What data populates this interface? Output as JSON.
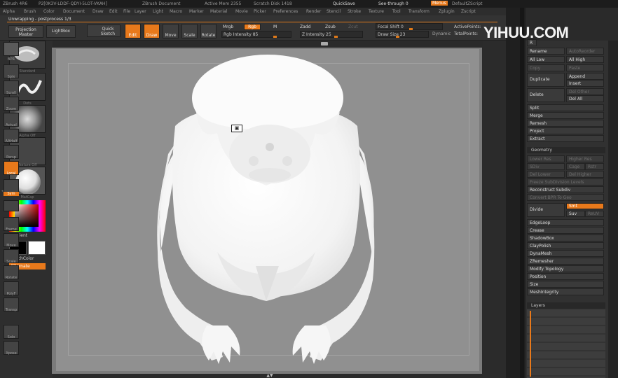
{
  "title_bar": {
    "app": "ZBrush 4R6",
    "doc_id": "P2[0K3V-LDDF-QDYI-5LOT-VKAH]",
    "document": "ZBrush Document",
    "active_mem": "Active Mem 2355",
    "scratch_disk": "Scratch Disk 1418",
    "quicksave": "QuickSave",
    "see_through": "See-through 0",
    "menus": "Menus",
    "script": "DefaultZScript"
  },
  "menus": [
    "Alpha",
    "Brush",
    "Color",
    "Document",
    "Draw",
    "Edit",
    "File",
    "Layer",
    "Light",
    "Macro",
    "Marker",
    "Material",
    "Movie",
    "Picker",
    "Preferences",
    "Render",
    "Stencil",
    "Stroke",
    "Texture",
    "Tool",
    "Transform",
    "Zplugin",
    "Zscript"
  ],
  "tabline": {
    "label": "Unwrapping - postprocess 1/3"
  },
  "toolbar": {
    "projection_master": "Projection Master",
    "lightbox": "LightBox",
    "quick_sketch": "Quick Sketch",
    "edit": "Edit",
    "draw": "Draw",
    "move": "Move",
    "scale": "Scale",
    "rotate": "Rotate",
    "mrgb": "Mrgb",
    "rgb": "Rgb",
    "m": "M",
    "zadd": "Zadd",
    "zsub": "Zsub",
    "zcut": "Zcut",
    "rgb_intensity": "Rgb Intensity 85",
    "z_intensity": "Z Intensity 25",
    "focal_shift": "Focal Shift 0",
    "draw_size": "Draw Size 23",
    "dynamic": "Dynamic",
    "active_points": "ActivePoints:",
    "total_points": "TotalPoints:"
  },
  "left_shelf": {
    "brush_label": "Standard",
    "stroke_label": "Dots",
    "alpha_label": "Alpha Off",
    "texture_label": "Texture Off",
    "material_label": "MatCap",
    "gradient": "Gradient",
    "switch_color": "SwitchColor",
    "alternate": "Alternate"
  },
  "right_shelf": {
    "items": [
      "BPR",
      "Spix",
      "Scroll",
      "Zoom",
      "Actual",
      "AAHalf",
      "Persp",
      "Floor",
      "Local",
      "Sym",
      "Frame",
      "Move",
      "Scale",
      "Rotate",
      "PolyF",
      "Transp",
      "Ghost",
      "Solo",
      "Xpose"
    ]
  },
  "tool_panel": {
    "top_buttons": [
      "R",
      "Rename",
      "AutoReorder",
      "All Low",
      "All High",
      "Copy",
      "Paste",
      "Duplicate",
      "Append",
      "Insert",
      "Delete",
      "Del Other",
      "Del All",
      "Split",
      "Merge",
      "Remesh",
      "Project",
      "Extract"
    ],
    "geometry_header": "Geometry",
    "geometry": [
      "Lower Res",
      "Higher Res",
      "SDiv",
      "Cage",
      "Rstr",
      "Del Lower",
      "Del Higher",
      "Freeze SubDivision Levels",
      "Reconstruct Subdiv",
      "Convert BPR To Geo",
      "Divide",
      "Smt",
      "Suv",
      "ReUV",
      "EdgeLoop",
      "Crease",
      "ShadowBox",
      "ClayPolish",
      "DynaMesh",
      "ZRemesher",
      "Modify Topology",
      "Position",
      "Size",
      "MeshIntegrity"
    ],
    "layers_header": "Layers"
  },
  "watermark": "YIHUU.COM",
  "canvas": {
    "cursor_icon": "camera-icon"
  },
  "colors": {
    "accent": "#e8791b",
    "canvas": "#909090",
    "panel": "#313131"
  }
}
